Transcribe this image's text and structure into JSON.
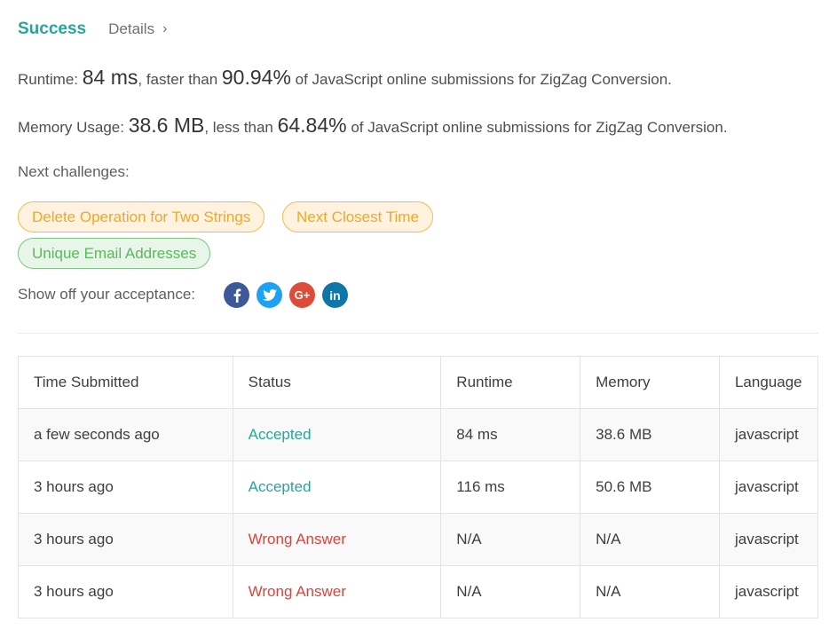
{
  "header": {
    "status": "Success",
    "details_label": "Details",
    "details_chevron": "›"
  },
  "runtime": {
    "prefix": "Runtime: ",
    "value": "84 ms",
    "middle": ", faster than ",
    "percent": "90.94%",
    "suffix": " of JavaScript online submissions for ZigZag Conversion."
  },
  "memory": {
    "prefix": "Memory Usage: ",
    "value": "38.6 MB",
    "middle": ", less than ",
    "percent": "64.84%",
    "suffix": " of JavaScript online submissions for ZigZag Conversion."
  },
  "next_challenges": {
    "label": "Next challenges:",
    "items": [
      {
        "label": "Delete Operation for Two Strings",
        "difficulty": "medium"
      },
      {
        "label": "Next Closest Time",
        "difficulty": "medium"
      },
      {
        "label": "Unique Email Addresses",
        "difficulty": "easy"
      }
    ]
  },
  "share": {
    "label": "Show off your acceptance:",
    "icons": [
      {
        "name": "facebook-icon",
        "color": "#3b5998",
        "glyph": "f"
      },
      {
        "name": "twitter-icon",
        "color": "#1da1f2",
        "glyph": ""
      },
      {
        "name": "google-plus-icon",
        "color": "#dd4b39",
        "glyph": "G+"
      },
      {
        "name": "linkedin-icon",
        "color": "#0e76a8",
        "glyph": "in"
      }
    ]
  },
  "colors": {
    "accent": "#26a69a",
    "wrong": "#d9443c",
    "medium": "#f5a623",
    "easy": "#5cb85c"
  },
  "table": {
    "headers": [
      "Time Submitted",
      "Status",
      "Runtime",
      "Memory",
      "Language"
    ],
    "rows": [
      {
        "time": "a few seconds ago",
        "status": "Accepted",
        "status_type": "accepted",
        "runtime": "84 ms",
        "memory": "38.6 MB",
        "language": "javascript"
      },
      {
        "time": "3 hours ago",
        "status": "Accepted",
        "status_type": "accepted",
        "runtime": "116 ms",
        "memory": "50.6 MB",
        "language": "javascript"
      },
      {
        "time": "3 hours ago",
        "status": "Wrong Answer",
        "status_type": "wrong",
        "runtime": "N/A",
        "memory": "N/A",
        "language": "javascript"
      },
      {
        "time": "3 hours ago",
        "status": "Wrong Answer",
        "status_type": "wrong",
        "runtime": "N/A",
        "memory": "N/A",
        "language": "javascript"
      }
    ]
  }
}
